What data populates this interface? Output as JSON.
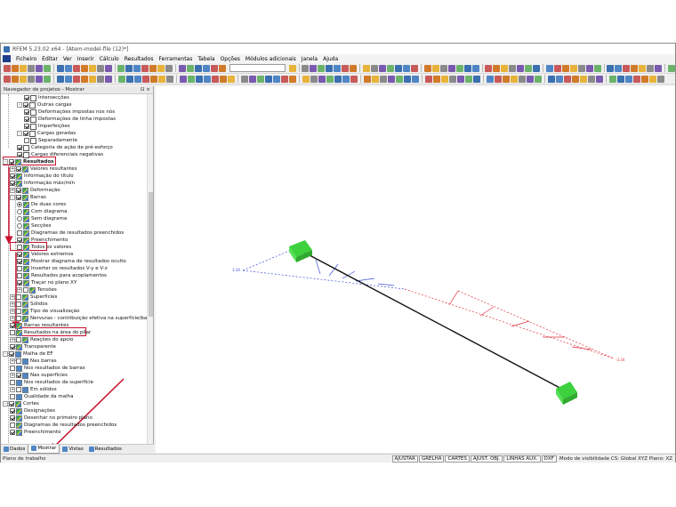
{
  "window": {
    "title": "RFEM 5.23.02 x64 - [Atem-model-file (12)*]"
  },
  "menu": [
    "Ficheiro",
    "Editar",
    "Ver",
    "Inserir",
    "Cálculo",
    "Resultados",
    "Ferramentas",
    "Tabela",
    "Opções",
    "Módulos adicionais",
    "Janela",
    "Ajuda"
  ],
  "navigator": {
    "title": "Navegador de projetos - Mostrar",
    "controls": "⊡ ×"
  },
  "tree": [
    {
      "label": "Intersecções",
      "level": 3,
      "kind": "cb",
      "checked": true,
      "icon": "load"
    },
    {
      "label": "Outras cargas",
      "level": 2,
      "kind": "cb",
      "checked": true,
      "expander": "-",
      "icon": "load"
    },
    {
      "label": "Deformações impostas nos nós",
      "level": 3,
      "kind": "cb",
      "checked": true,
      "icon": "load"
    },
    {
      "label": "Deformações de linha impostas",
      "level": 3,
      "kind": "cb",
      "checked": true,
      "icon": "load"
    },
    {
      "label": "Imperfeições",
      "level": 3,
      "kind": "cb",
      "checked": true,
      "icon": "load"
    },
    {
      "label": "Cargas geradas",
      "level": 2,
      "kind": "cb",
      "checked": true,
      "expander": "-",
      "icon": "load"
    },
    {
      "label": "Separadamente",
      "level": 3,
      "kind": "cb",
      "checked": false,
      "icon": "load"
    },
    {
      "label": "Categoria de ação de pré-esforço",
      "level": 2,
      "kind": "cb",
      "checked": true,
      "icon": "load"
    },
    {
      "label": "Cargas diferenciais negativas",
      "level": 2,
      "kind": "cb",
      "checked": true,
      "icon": "load"
    },
    {
      "label": "Resultados",
      "level": 0,
      "kind": "cb",
      "checked": true,
      "expander": "-",
      "icon": "res",
      "bold": true
    },
    {
      "label": "Valores resultantes",
      "level": 1,
      "kind": "cb",
      "checked": true,
      "expander": "+",
      "icon": "res"
    },
    {
      "label": "Informação do título",
      "level": 1,
      "kind": "cb",
      "checked": true,
      "icon": "res"
    },
    {
      "label": "Informação máx/mín",
      "level": 1,
      "kind": "cb",
      "checked": true,
      "icon": "res"
    },
    {
      "label": "Deformação",
      "level": 1,
      "kind": "cb",
      "checked": true,
      "expander": "+",
      "icon": "res"
    },
    {
      "label": "Barras",
      "level": 1,
      "kind": "cb",
      "checked": true,
      "expander": "-",
      "icon": "res"
    },
    {
      "label": "De duas cores",
      "level": 2,
      "kind": "rb",
      "checked": true,
      "icon": "res"
    },
    {
      "label": "Com diagrama",
      "level": 2,
      "kind": "rb",
      "checked": false,
      "icon": "res"
    },
    {
      "label": "Sem diagrama",
      "level": 2,
      "kind": "rb",
      "checked": false,
      "icon": "res"
    },
    {
      "label": "Secções",
      "level": 2,
      "kind": "rb",
      "checked": false,
      "icon": "res"
    },
    {
      "label": "Diagramas de resultados preenchidos",
      "level": 2,
      "kind": "cb",
      "checked": false,
      "icon": "res"
    },
    {
      "label": "Preenchimento",
      "level": 2,
      "kind": "cb",
      "checked": true,
      "icon": "res"
    },
    {
      "label": "Todos os valores",
      "level": 2,
      "kind": "cb",
      "checked": false,
      "icon": "res"
    },
    {
      "label": "Valores extremos",
      "level": 2,
      "kind": "cb",
      "checked": true,
      "icon": "res"
    },
    {
      "label": "Mostrar diagrama de resultados oculto",
      "level": 2,
      "kind": "cb",
      "checked": true,
      "icon": "res"
    },
    {
      "label": "Inverter os resultados V-y e V-z",
      "level": 2,
      "kind": "cb",
      "checked": false,
      "icon": "res"
    },
    {
      "label": "Resultados para acoplamentos",
      "level": 2,
      "kind": "cb",
      "checked": false,
      "icon": "res"
    },
    {
      "label": "Traçar no plano XY",
      "level": 2,
      "kind": "cb",
      "checked": true,
      "icon": "res"
    },
    {
      "label": "Tensões",
      "level": 2,
      "kind": "cb",
      "checked": false,
      "expander": "+",
      "icon": "res"
    },
    {
      "label": "Superfícies",
      "level": 1,
      "kind": "cb",
      "checked": false,
      "expander": "+",
      "icon": "res"
    },
    {
      "label": "Sólidos",
      "level": 1,
      "kind": "cb",
      "checked": false,
      "expander": "+",
      "icon": "res"
    },
    {
      "label": "Tipo de visualização",
      "level": 1,
      "kind": "cb",
      "checked": false,
      "expander": "+",
      "icon": "res"
    },
    {
      "label": "Nervuras - contribuição efetiva na superfície/barra",
      "level": 1,
      "kind": "cb",
      "checked": false,
      "expander": "+",
      "icon": "res"
    },
    {
      "label": "Barras resultantes",
      "level": 1,
      "kind": "cb",
      "checked": true,
      "icon": "res"
    },
    {
      "label": "Resultados na área do pilar",
      "level": 1,
      "kind": "cb",
      "checked": false,
      "icon": "res"
    },
    {
      "label": "Reações do apoio",
      "level": 1,
      "kind": "cb",
      "checked": false,
      "expander": "+",
      "icon": "res"
    },
    {
      "label": "Transparente",
      "level": 1,
      "kind": "cb",
      "checked": true,
      "icon": "res"
    },
    {
      "label": "Malha de EF",
      "level": 0,
      "kind": "cb",
      "checked": true,
      "expander": "-",
      "icon": "blue"
    },
    {
      "label": "Nas barras",
      "level": 1,
      "kind": "cb",
      "checked": false,
      "expander": "+",
      "icon": "blue"
    },
    {
      "label": "Nos resultados de barras",
      "level": 1,
      "kind": "cb",
      "checked": false,
      "icon": "blue"
    },
    {
      "label": "Nas superfícies",
      "level": 1,
      "kind": "cb",
      "checked": true,
      "expander": "+",
      "icon": "blue"
    },
    {
      "label": "Nos resultados da superfície",
      "level": 1,
      "kind": "cb",
      "checked": false,
      "icon": "blue"
    },
    {
      "label": "Em sólidos",
      "level": 1,
      "kind": "cb",
      "checked": false,
      "expander": "+",
      "icon": "blue"
    },
    {
      "label": "Qualidade da malha",
      "level": 1,
      "kind": "cb",
      "checked": false,
      "icon": "blue"
    },
    {
      "label": "Cortes",
      "level": 0,
      "kind": "cb",
      "checked": true,
      "expander": "-",
      "icon": "res"
    },
    {
      "label": "Designações",
      "level": 1,
      "kind": "cb",
      "checked": true,
      "icon": "res"
    },
    {
      "label": "Desenhar no primeiro plano",
      "level": 1,
      "kind": "cb",
      "checked": true,
      "icon": "res"
    },
    {
      "label": "Diagramas de resultados preenchidos",
      "level": 1,
      "kind": "cb",
      "checked": false,
      "icon": "res"
    },
    {
      "label": "Preenchimento",
      "level": 1,
      "kind": "cb",
      "checked": true,
      "icon": "res"
    }
  ],
  "bottom_tabs": [
    "Dados",
    "Mostrar",
    "Vistas",
    "Resultados"
  ],
  "active_tab": "Mostrar",
  "status": {
    "left": "Plano de trabalho",
    "buttons": [
      "AJUSTAR",
      "GRELHA",
      "CARTES",
      "AJUST. OBJ.",
      "LINHAS AUX.",
      "DXF"
    ],
    "info": "Modo de visibilidade CS: Global XYZ    Plano: XZ"
  },
  "model": {
    "value_left": "3.34",
    "value_right": "-3.34",
    "positive_color": "#3b4fd8",
    "negative_color": "#e0303a",
    "support_color": "#3dd13d",
    "member_color": "#111111",
    "highlight_color": "#c8102e"
  }
}
